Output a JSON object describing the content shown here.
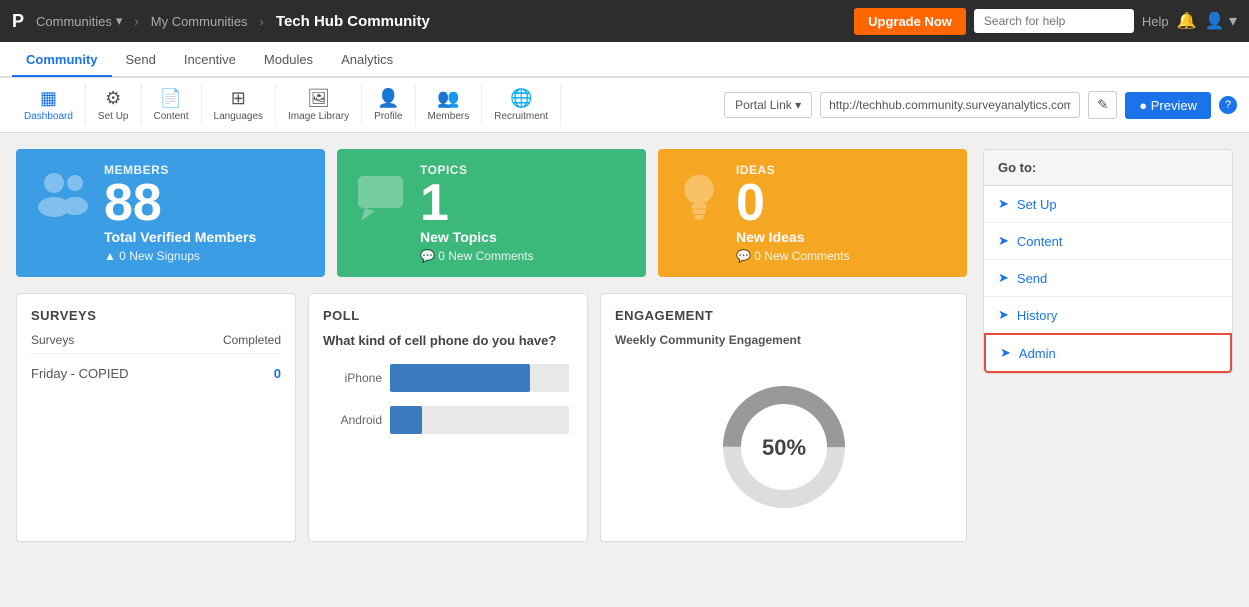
{
  "topnav": {
    "brand": "P",
    "communities_label": "Communities",
    "dropdown_arrow": "▾",
    "sep1": "›",
    "my_communities": "My Communities",
    "sep2": "›",
    "page_title": "Tech Hub Community",
    "upgrade_btn": "Upgrade Now",
    "search_placeholder": "Search for help",
    "help_label": "Help",
    "bell_icon": "🔔",
    "user_icon": "👤"
  },
  "secondnav": {
    "items": [
      {
        "label": "Community",
        "active": true
      },
      {
        "label": "Send",
        "active": false
      },
      {
        "label": "Incentive",
        "active": false
      },
      {
        "label": "Modules",
        "active": false
      },
      {
        "label": "Analytics",
        "active": false
      }
    ]
  },
  "toolbar": {
    "tools": [
      {
        "label": "Dashboard",
        "active": true,
        "icon": "▦"
      },
      {
        "label": "Set Up",
        "active": false,
        "icon": "⚙"
      },
      {
        "label": "Content",
        "active": false,
        "icon": "📄"
      },
      {
        "label": "Languages",
        "active": false,
        "icon": "⊞"
      },
      {
        "label": "Image Library",
        "active": false,
        "icon": "🖼"
      },
      {
        "label": "Profile",
        "active": false,
        "icon": "👤"
      },
      {
        "label": "Members",
        "active": false,
        "icon": "👥"
      },
      {
        "label": "Recruitment",
        "active": false,
        "icon": "🌐"
      }
    ],
    "portal_link_label": "Portal Link ▾",
    "portal_url": "http://techhub.community.surveyanalytics.com",
    "edit_icon": "✎",
    "preview_label": "● Preview",
    "help_icon": "?"
  },
  "members_card": {
    "label": "MEMBERS",
    "number": "88",
    "subtitle": "Total Verified Members",
    "subinfo": "▲ 0 New Signups",
    "icon": "👥"
  },
  "topics_card": {
    "label": "TOPICS",
    "number": "1",
    "subtitle": "New Topics",
    "subinfo": "💬 0 New Comments",
    "icon": "💬"
  },
  "ideas_card": {
    "label": "IDEAS",
    "number": "0",
    "subtitle": "New Ideas",
    "subinfo": "💬 0 New Comments",
    "icon": "💡"
  },
  "surveys_widget": {
    "title": "SURVEYS",
    "col1": "Surveys",
    "col2": "Completed",
    "rows": [
      {
        "name": "Friday - COPIED",
        "completed": "0"
      }
    ]
  },
  "poll_widget": {
    "title": "POLL",
    "question": "What kind of cell phone do you have?",
    "bars": [
      {
        "label": "iPhone",
        "pct": 78
      },
      {
        "label": "Android",
        "pct": 18
      }
    ]
  },
  "engagement_widget": {
    "title": "ENGAGEMENT",
    "subtitle": "Weekly Community Engagement",
    "percent": "50%",
    "filled_pct": 50,
    "color_filled": "#888",
    "color_empty": "#ddd"
  },
  "goto": {
    "header": "Go to:",
    "items": [
      {
        "label": "Set Up",
        "icon": "➤"
      },
      {
        "label": "Content",
        "icon": "➤"
      },
      {
        "label": "Send",
        "icon": "➤"
      },
      {
        "label": "History",
        "icon": "➤"
      },
      {
        "label": "Admin",
        "icon": "➤",
        "admin": true
      }
    ]
  }
}
